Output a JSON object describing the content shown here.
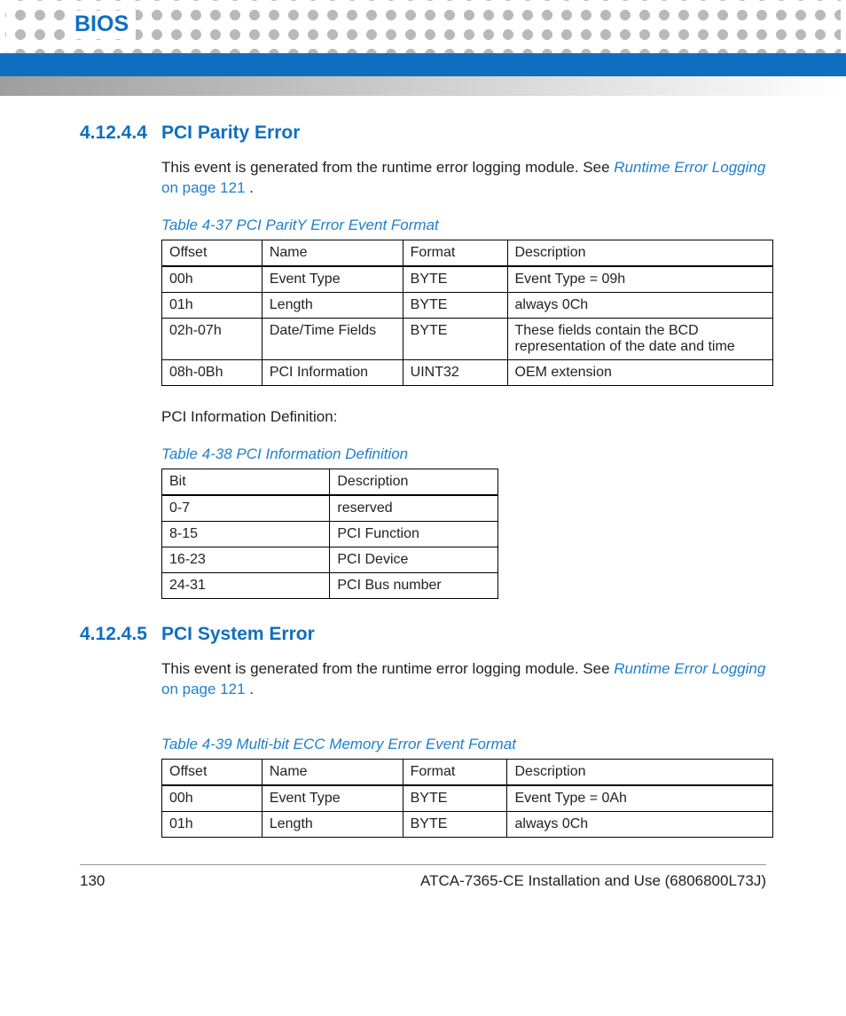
{
  "header": {
    "title": "BIOS"
  },
  "sections": [
    {
      "num": "4.12.4.4",
      "title": "PCI Parity Error",
      "para_pre": "This event is generated from the runtime error logging module. See ",
      "link": "Runtime Error Logging",
      "para_mid": " on page 121",
      "para_post": " ."
    },
    {
      "num": "4.12.4.5",
      "title": "PCI System Error",
      "para_pre": "This event is generated from the runtime error logging module. See ",
      "link": "Runtime Error Logging",
      "para_mid": " on page 121",
      "para_post": " ."
    }
  ],
  "pci_info_label": "PCI Information Definition:",
  "tables": {
    "t1": {
      "caption": "Table 4-37 PCI ParitY Error Event Format",
      "headers": [
        "Offset",
        "Name",
        "Format",
        "Description"
      ],
      "rows": [
        [
          "00h",
          "Event Type",
          "BYTE",
          "Event Type = 09h"
        ],
        [
          "01h",
          "Length",
          "BYTE",
          "always 0Ch"
        ],
        [
          "02h-07h",
          "Date/Time Fields",
          "BYTE",
          "These fields contain the BCD representation of the date and time"
        ],
        [
          "08h-0Bh",
          "PCI Information",
          "UINT32",
          "OEM extension"
        ]
      ]
    },
    "t2": {
      "caption": "Table 4-38 PCI Information Definition",
      "headers": [
        "Bit",
        "Description"
      ],
      "rows": [
        [
          "0-7",
          "reserved"
        ],
        [
          "8-15",
          "PCI Function"
        ],
        [
          "16-23",
          "PCI Device"
        ],
        [
          "24-31",
          "PCI Bus number"
        ]
      ]
    },
    "t3": {
      "caption": "Table 4-39 Multi-bit ECC Memory Error Event Format",
      "headers": [
        "Offset",
        "Name",
        "Format",
        "Description"
      ],
      "rows": [
        [
          "00h",
          "Event Type",
          "BYTE",
          "Event Type = 0Ah"
        ],
        [
          "01h",
          "Length",
          "BYTE",
          "always 0Ch"
        ]
      ]
    }
  },
  "footer": {
    "page": "130",
    "doc": "ATCA-7365-CE Installation and Use (6806800L73J)"
  }
}
